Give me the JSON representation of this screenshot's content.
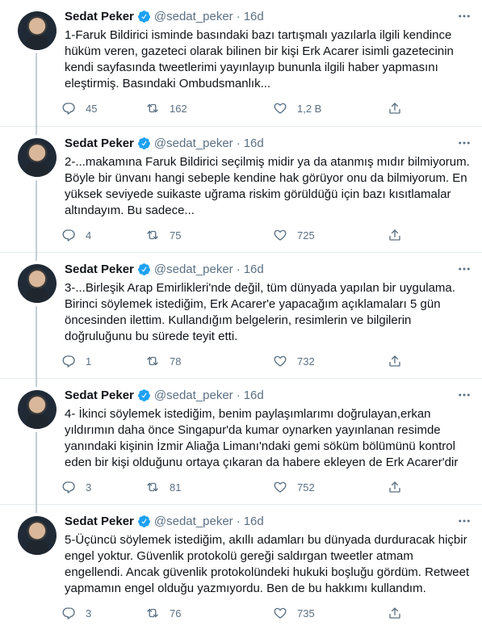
{
  "tweets": [
    {
      "name": "Sedat Peker",
      "handle": "@sedat_peker",
      "dot": "·",
      "time": "16d",
      "text": "1-Faruk Bildirici isminde basındaki bazı tartışmalı yazılarla ilgili kendince hüküm veren, gazeteci olarak bilinen bir kişi Erk Acarer isimli gazetecinin kendi sayfasında tweetlerimi yayınlayıp bununla ilgili haber yapmasını eleştirmiş. Basındaki Ombudsmanlık...",
      "replies": "45",
      "retweets": "162",
      "likes": "1,2 B"
    },
    {
      "name": "Sedat Peker",
      "handle": "@sedat_peker",
      "dot": "·",
      "time": "16d",
      "text": "2-...makamına Faruk Bildirici seçilmiş midir ya da atanmış mıdır bilmiyorum. Böyle bir ünvanı hangi sebeple kendine hak görüyor onu da bilmiyorum.  En yüksek seviyede suikaste uğrama riskim görüldüğü için bazı kısıtlamalar altındayım. Bu sadece...",
      "replies": "4",
      "retweets": "75",
      "likes": "725"
    },
    {
      "name": "Sedat Peker",
      "handle": "@sedat_peker",
      "dot": "·",
      "time": "16d",
      "text": "3-...Birleşik Arap Emirlikleri'nde değil, tüm dünyada yapılan bir uygulama. Birinci söylemek istediğim, Erk Acarer'e yapacağım açıklamaları 5 gün öncesinden ilettim. Kullandığım belgelerin, resimlerin ve bilgilerin doğruluğunu bu sürede teyit etti.",
      "replies": "1",
      "retweets": "78",
      "likes": "732"
    },
    {
      "name": "Sedat Peker",
      "handle": "@sedat_peker",
      "dot": "·",
      "time": "16d",
      "text": "4- İkinci söylemek istediğim, benim paylaşımlarımı doğrulayan,erkan yıldırımın daha önce Singapur'da kumar oynarken yayınlanan resimde yanındaki kişinin İzmir Aliağa Limanı'ndaki gemi söküm bölümünü kontrol eden bir kişi olduğunu ortaya çıkaran da habere ekleyen de Erk Acarer'dir",
      "replies": "3",
      "retweets": "81",
      "likes": "752"
    },
    {
      "name": "Sedat Peker",
      "handle": "@sedat_peker",
      "dot": "·",
      "time": "16d",
      "text": "5-Üçüncü söylemek istediğim, akıllı adamları bu dünyada durduracak hiçbir engel yoktur. Güvenlik protokolü gereği saldırgan tweetler atmam engellendi. Ancak güvenlik protokolündeki hukuki boşluğu gördüm. Retweet yapmamın engel olduğu yazmıyordu. Ben de bu hakkımı kullandım.",
      "replies": "3",
      "retweets": "76",
      "likes": "735"
    }
  ],
  "colors": {
    "text": "#0f1419",
    "muted": "#5b7083",
    "verified": "#1da1f2",
    "divider": "#e6ecf0",
    "thread_line": "#c4cfd6"
  },
  "icons": [
    "verified-badge-icon",
    "more-options-icon",
    "reply-icon",
    "retweet-icon",
    "like-icon",
    "share-icon"
  ]
}
